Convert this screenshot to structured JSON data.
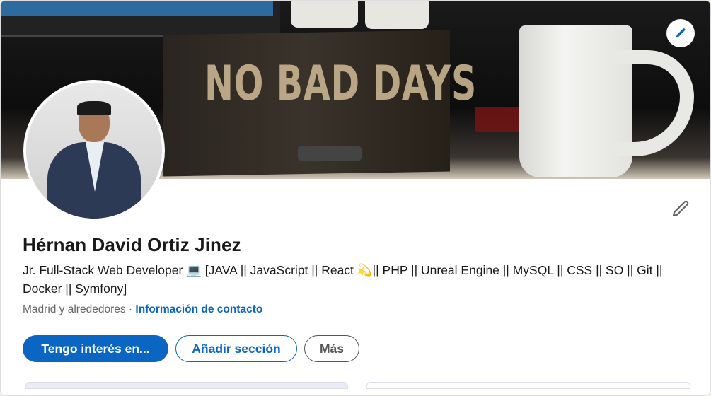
{
  "banner": {
    "photo_text": "NO BAD DAYS",
    "edit_icon": "pencil-icon"
  },
  "profile": {
    "name": "Hérnan David Ortiz Jinez",
    "headline": "Jr. Full-Stack Web Developer 💻 [JAVA || JavaScript || React 💫|| PHP || Unreal Engine || MySQL || CSS || SO || Git || Docker || Symfony]",
    "location": "Madrid y alrededores",
    "separator": " · ",
    "contact_link": "Información de contacto"
  },
  "actions": {
    "primary": "Tengo interés en...",
    "add_section": "Añadir sección",
    "more": "Más"
  },
  "colors": {
    "accent": "#0a66c2",
    "text": "#191919",
    "muted": "#666666"
  }
}
